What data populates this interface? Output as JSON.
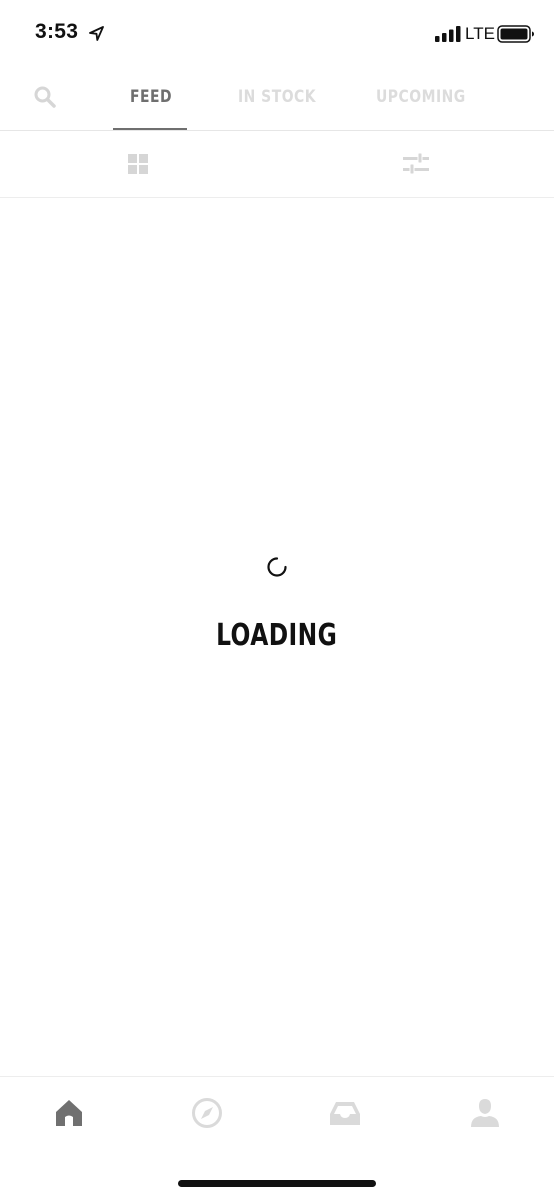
{
  "status_bar": {
    "time": "3:53",
    "network": "LTE"
  },
  "top_nav": {
    "tabs": [
      {
        "label": "FEED",
        "active": true
      },
      {
        "label": "IN STOCK",
        "active": false
      },
      {
        "label": "UPCOMING",
        "active": false
      }
    ]
  },
  "toolbar": {
    "icons": [
      "grid-view-icon",
      "filter-icon"
    ]
  },
  "main": {
    "loading_text": "LOADING"
  },
  "bottom_nav": {
    "items": [
      "home-icon",
      "discover-icon",
      "inbox-icon",
      "profile-icon"
    ],
    "active": "home-icon"
  },
  "colors": {
    "active_tab": "#6f6f6f",
    "inactive_tab": "#dcdcdc",
    "text": "#111111"
  }
}
